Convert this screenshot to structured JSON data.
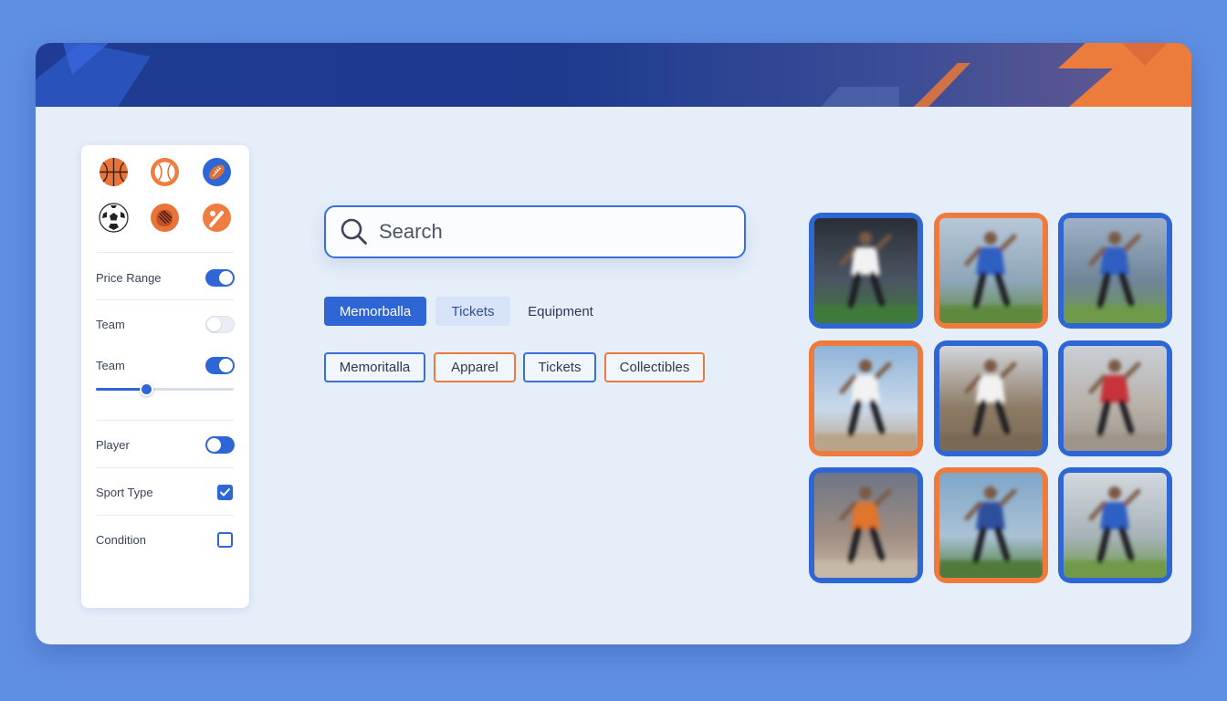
{
  "colors": {
    "primary": "#2f66d6",
    "accent": "#ee7a3c",
    "background": "#5f8fe3",
    "panel": "#e6eefa"
  },
  "sidebar": {
    "sport_icons": [
      "basketball-icon",
      "baseball-icon",
      "football-icon",
      "soccer-ball-icon",
      "glove-icon",
      "bat-and-ball-icon"
    ],
    "filters": [
      {
        "label": "Price Range",
        "control": "toggle",
        "on": true
      },
      {
        "label": "Team",
        "control": "toggle",
        "on": false
      },
      {
        "label": "Team",
        "control": "toggle",
        "on": true,
        "slider_value_fraction": 0.37
      },
      {
        "label": "Player",
        "control": "toggle",
        "on": false
      },
      {
        "label": "Sport Type",
        "control": "checkbox",
        "checked": true
      },
      {
        "label": "Condition",
        "control": "checkbox",
        "checked": false
      }
    ]
  },
  "search": {
    "placeholder": "Search",
    "icon": "search-icon"
  },
  "tabs": [
    {
      "label": "Memorballa",
      "state": "active"
    },
    {
      "label": "Tickets",
      "state": "highlighted"
    },
    {
      "label": "Equipment",
      "state": "plain"
    }
  ],
  "chips": [
    {
      "label": "Memoritalla",
      "color": "blue"
    },
    {
      "label": "Apparel",
      "color": "orange"
    },
    {
      "label": "Tickets",
      "color": "blue"
    },
    {
      "label": "Collectibles",
      "color": "orange"
    }
  ],
  "product_grid": [
    {
      "border": "blue",
      "jersey": "#f2f2f2"
    },
    {
      "border": "orange",
      "jersey": "#2f5fc2"
    },
    {
      "border": "blue",
      "jersey": "#2f5fc2"
    },
    {
      "border": "orange",
      "jersey": "#f2f2f2"
    },
    {
      "border": "blue",
      "jersey": "#f2f2f2"
    },
    {
      "border": "blue",
      "jersey": "#c8313a"
    },
    {
      "border": "blue",
      "jersey": "#e0742e"
    },
    {
      "border": "orange",
      "jersey": "#2d4f9c"
    },
    {
      "border": "blue",
      "jersey": "#2f5fc2"
    }
  ]
}
